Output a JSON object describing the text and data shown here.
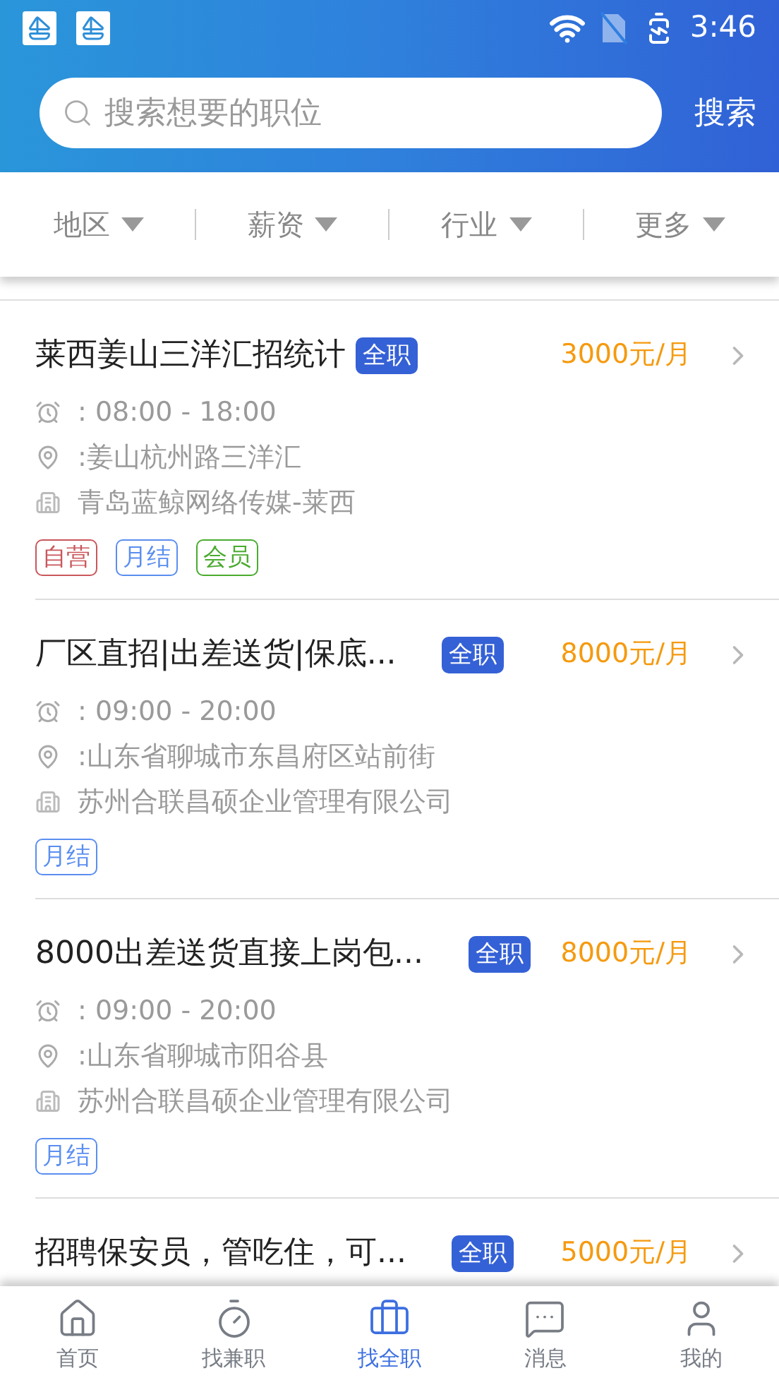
{
  "status_bar": {
    "time": "3:46"
  },
  "search": {
    "placeholder": "搜索想要的职位",
    "button": "搜索"
  },
  "filters": [
    {
      "label": "地区"
    },
    {
      "label": "薪资"
    },
    {
      "label": "行业"
    },
    {
      "label": "更多"
    }
  ],
  "jobs": [
    {
      "title": "莱西姜山三洋汇招统计",
      "badge": "全职",
      "salary": "3000元/月",
      "time": ": 08:00 - 18:00",
      "address": ":姜山杭州路三洋汇",
      "company": "青岛蓝鲸网络传媒-莱西",
      "tags": [
        {
          "label": "自营",
          "color": "#c9575c"
        },
        {
          "label": "月结",
          "color": "#5b8ef0"
        },
        {
          "label": "会员",
          "color": "#4aab2f"
        }
      ]
    },
    {
      "title": "厂区直招|出差送货|保底...",
      "badge": "全职",
      "salary": "8000元/月",
      "time": ": 09:00 - 20:00",
      "address": ":山东省聊城市东昌府区站前街",
      "company": "苏州合联昌硕企业管理有限公司",
      "tags": [
        {
          "label": "月结",
          "color": "#5b8ef0"
        }
      ]
    },
    {
      "title": "8000出差送货直接上岗包...",
      "badge": "全职",
      "salary": "8000元/月",
      "time": ": 09:00 - 20:00",
      "address": ":山东省聊城市阳谷县",
      "company": "苏州合联昌硕企业管理有限公司",
      "tags": [
        {
          "label": "月结",
          "color": "#5b8ef0"
        }
      ]
    },
    {
      "title": "招聘保安员，管吃住，可...",
      "badge": "全职",
      "salary": "5000元/月"
    }
  ],
  "nav": [
    {
      "label": "首页",
      "kind": "home",
      "selected": false
    },
    {
      "label": "找兼职",
      "kind": "parttime",
      "selected": false
    },
    {
      "label": "找全职",
      "kind": "fulltime",
      "selected": true
    },
    {
      "label": "消息",
      "kind": "message",
      "selected": false
    },
    {
      "label": "我的",
      "kind": "profile",
      "selected": false
    }
  ]
}
